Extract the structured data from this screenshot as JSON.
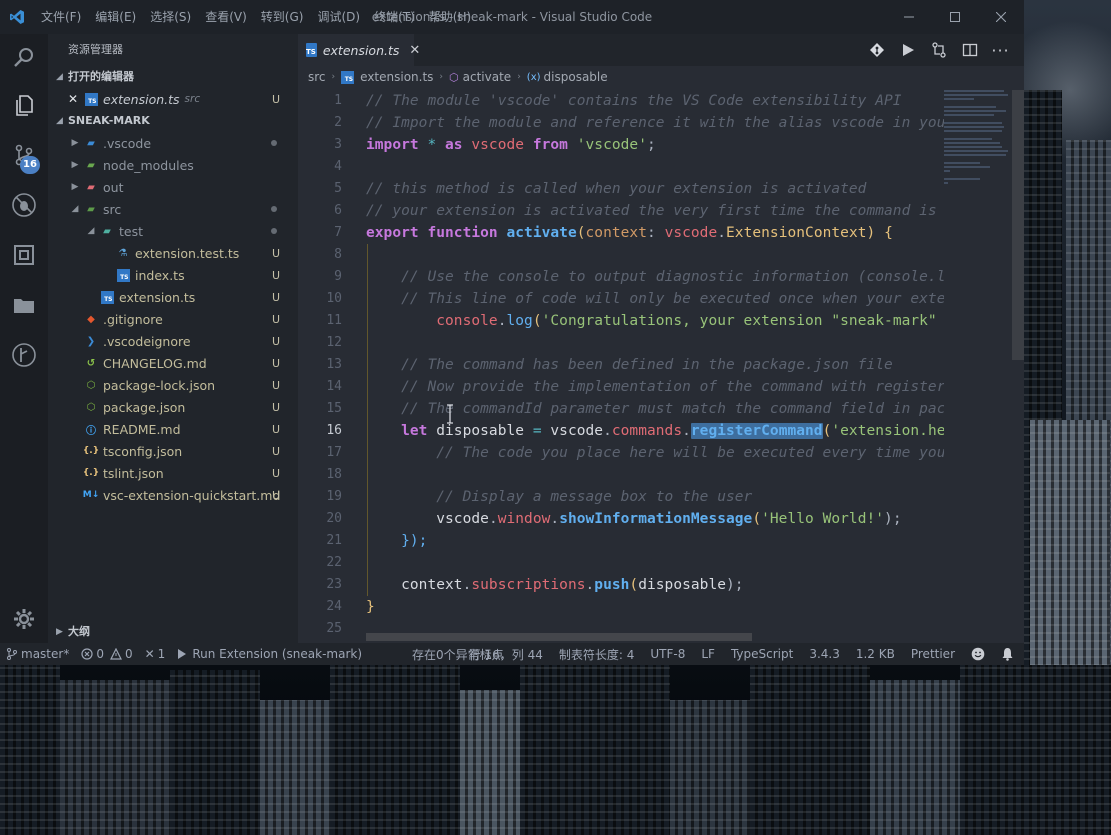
{
  "window": {
    "title": "extension.ts - sneak-mark - Visual Studio Code",
    "menu": [
      "文件(F)",
      "编辑(E)",
      "选择(S)",
      "查看(V)",
      "转到(G)",
      "调试(D)",
      "终端(T)",
      "帮助(H)"
    ]
  },
  "activity": {
    "scm_badge": "16"
  },
  "sidebar": {
    "title": "资源管理器",
    "open_editors_label": "打开的编辑器",
    "open_editor": {
      "name": "extension.ts",
      "path": "src",
      "status": "U"
    },
    "project_label": "SNEAK-MARK",
    "outline_label": "大纲",
    "tree": [
      {
        "name": ".vscode",
        "status": "",
        "icon": "folder-vscode-icon"
      },
      {
        "name": "node_modules",
        "status": "",
        "icon": "folder-node-icon"
      },
      {
        "name": "out",
        "status": "",
        "icon": "folder-out-icon"
      },
      {
        "name": "src",
        "status": "",
        "icon": "folder-src-icon"
      },
      {
        "name": "test",
        "status": "",
        "icon": "folder-test-icon"
      },
      {
        "name": "extension.test.ts",
        "status": "U",
        "icon": "test-file-icon"
      },
      {
        "name": "index.ts",
        "status": "U",
        "icon": "typescript-file-icon"
      },
      {
        "name": "extension.ts",
        "status": "U",
        "icon": "typescript-file-icon"
      },
      {
        "name": ".gitignore",
        "status": "U",
        "icon": "git-file-icon"
      },
      {
        "name": ".vscodeignore",
        "status": "U",
        "icon": "vscode-file-icon"
      },
      {
        "name": "CHANGELOG.md",
        "status": "U",
        "icon": "changelog-file-icon"
      },
      {
        "name": "package-lock.json",
        "status": "U",
        "icon": "npm-file-icon"
      },
      {
        "name": "package.json",
        "status": "U",
        "icon": "npm-file-icon"
      },
      {
        "name": "README.md",
        "status": "U",
        "icon": "readme-file-icon"
      },
      {
        "name": "tsconfig.json",
        "status": "U",
        "icon": "json-file-icon"
      },
      {
        "name": "tslint.json",
        "status": "U",
        "icon": "json-file-icon"
      },
      {
        "name": "vsc-extension-quickstart.md",
        "status": "U",
        "icon": "markdown-file-icon"
      }
    ]
  },
  "editor": {
    "tab_label": "extension.ts",
    "breadcrumb": [
      "src",
      "extension.ts",
      "activate",
      "disposable"
    ],
    "line_numbers": [
      "1",
      "2",
      "3",
      "4",
      "5",
      "6",
      "7",
      "8",
      "9",
      "10",
      "11",
      "12",
      "13",
      "14",
      "15",
      "16",
      "17",
      "18",
      "19",
      "20",
      "21",
      "22",
      "23",
      "24",
      "25"
    ],
    "active_line": "16",
    "code": {
      "l1": "// The module 'vscode' contains the VS Code extensibility API",
      "l2": "// Import the module and reference it with the alias vscode in your code below",
      "l3_kw1": "import",
      "l3_op": " * ",
      "l3_kw2": "as",
      "l3_var": " vscode ",
      "l3_kw3": "from",
      "l3_str": " 'vscode'",
      "l3_end": ";",
      "l5": "// this method is called when your extension is activated",
      "l6": "// your extension is activated the very first time the command is executed",
      "l7_kw1": "export",
      "l7_kw2": " function",
      "l7_fn": " activate",
      "l7_p1": "(",
      "l7_param": "context",
      "l7_colon": ": ",
      "l7_ns": "vscode",
      "l7_dot": ".",
      "l7_type": "ExtensionContext",
      "l7_end": ") {",
      "l9": "// Use the console to output diagnostic information (console.log) and errors (console.error)",
      "l10": "// This line of code will only be executed once when your extension is activated",
      "l11_obj": "console",
      "l11_dot": ".",
      "l11_fn": "log",
      "l11_p": "(",
      "l11_str": "'Congratulations, your extension \"sneak-mark\" is now active!'",
      "l11_end": ");",
      "l13": "// The command has been defined in the package.json file",
      "l14": "// Now provide the implementation of the command with registerCommand",
      "l15": "// The commandId parameter must match the command field in package.json",
      "l16_kw": "let",
      "l16_var": " disposable ",
      "l16_op": "=",
      "l16_ns": " vscode",
      "l16_dot1": ".",
      "l16_prop": "commands",
      "l16_dot2": ".",
      "l16_fn": "registerCommand",
      "l16_p": "(",
      "l16_str": "'extension.helloWorld'",
      "l16_end": ", () => {",
      "l17": "// The code you place here will be executed every time your command is executed",
      "l19": "// Display a message box to the user",
      "l20_ns": "vscode",
      "l20_dot1": ".",
      "l20_prop": "window",
      "l20_dot2": ".",
      "l20_fn": "showInformationMessage",
      "l20_p": "(",
      "l20_str": "'Hello World!'",
      "l20_end": ");",
      "l21": "});",
      "l23_var": "context",
      "l23_dot1": ".",
      "l23_prop": "subscriptions",
      "l23_dot2": ".",
      "l23_fn": "push",
      "l23_p": "(",
      "l23_arg": "disposable",
      "l23_end": ");",
      "l24": "}"
    }
  },
  "status": {
    "branch": "master*",
    "errors": "0",
    "warnings": "0",
    "tools": "1",
    "run": "Run Extension (sneak-mark)",
    "problems": "存在0个异常标点",
    "position": "行 16，列 44",
    "tab_size": "制表符长度: 4",
    "encoding": "UTF-8",
    "eol": "LF",
    "language": "TypeScript",
    "ts_version": "3.4.3",
    "file_size": "1.2 KB",
    "formatter": "Prettier"
  },
  "colors": {
    "accent": "#4b80c4",
    "keyword": "#c678dd",
    "string": "#98c379",
    "function": "#61afef",
    "property": "#e06c75",
    "type": "#e5c07b",
    "comment": "#5c6370",
    "git_untracked": "#c5c0a8"
  }
}
